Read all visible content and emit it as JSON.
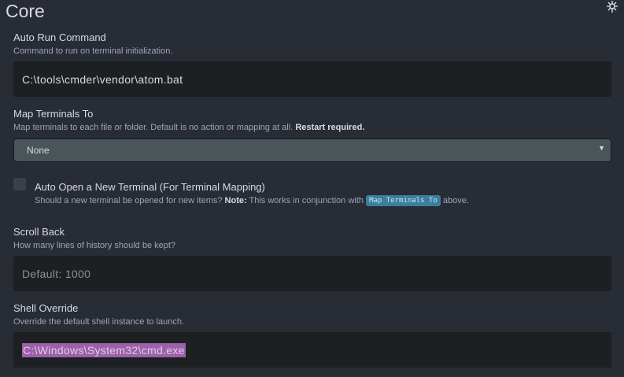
{
  "section": {
    "title": "Core"
  },
  "settings": {
    "auto_run": {
      "label": "Auto Run Command",
      "description": "Command to run on terminal initialization.",
      "value": "C:\\tools\\cmder\\vendor\\atom.bat"
    },
    "map_terminals": {
      "label": "Map Terminals To",
      "description": "Map terminals to each file or folder. Default is no action or mapping at all.",
      "description_bold": "Restart required.",
      "selected": "None"
    },
    "auto_open": {
      "label": "Auto Open a New Terminal (For Terminal Mapping)",
      "description_start": "Should a new terminal be opened for new items?",
      "description_note_label": "Note:",
      "description_middle": "This works in conjunction with",
      "description_code": "Map Terminals To",
      "description_end": "above.",
      "checked": false
    },
    "scroll_back": {
      "label": "Scroll Back",
      "description": "How many lines of history should be kept?",
      "placeholder": "Default: 1000"
    },
    "shell_override": {
      "label": "Shell Override",
      "description": "Override the default shell instance to launch.",
      "value": "C:\\Windows\\System32\\cmd.exe"
    }
  },
  "icons": {
    "pin": "pin-icon",
    "dropdown": "chevron-down-icon"
  },
  "colors": {
    "background": "#282c34",
    "input_background": "#1d1f23",
    "select_background": "#4a555a",
    "code_pill": "#3c7e9e",
    "selection": "#9b62a8"
  }
}
